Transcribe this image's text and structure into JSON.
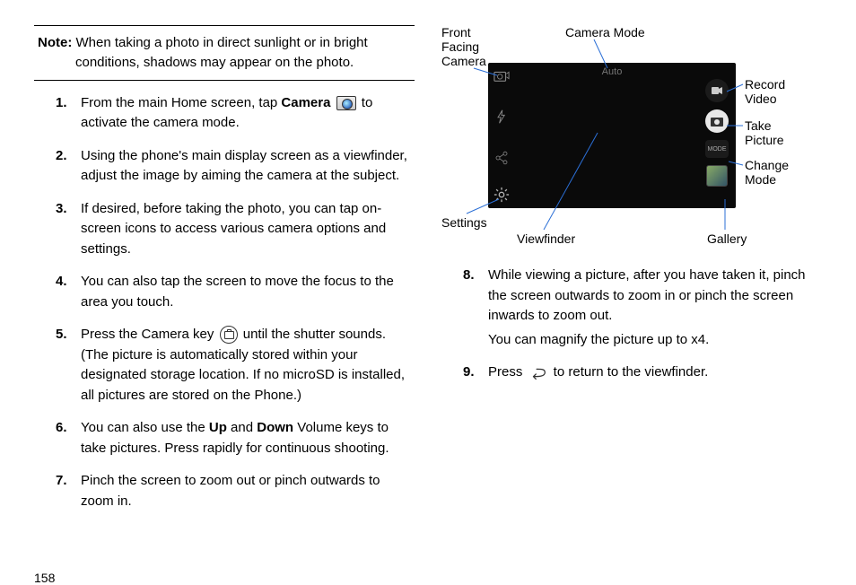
{
  "note": {
    "prefix": "Note:",
    "text": " When taking a photo in direct sunlight or in bright conditions, shadows may appear on the photo."
  },
  "steps_left": [
    {
      "num": "1.",
      "html": "From the main Home screen, tap <b>Camera</b> {camera} to activate the camera mode."
    },
    {
      "num": "2.",
      "html": "Using the phone's main display screen as a viewfinder, adjust the image by aiming the camera at the subject."
    },
    {
      "num": "3.",
      "html": "If desired, before taking the photo, you can tap on-screen icons to access various camera options and settings."
    },
    {
      "num": "4.",
      "html": "You can also tap the screen to move the focus to the area you touch."
    },
    {
      "num": "5.",
      "html": "Press the Camera key {key} until the shutter sounds. (The picture is automatically stored within your designated storage location. If no microSD is installed, all pictures are stored on the Phone.)"
    },
    {
      "num": "6.",
      "html": "You can also use the <b>Up</b> and <b>Down</b> Volume keys to take pictures. Press rapidly for continuous shooting."
    },
    {
      "num": "7.",
      "html": "Pinch the screen to zoom out or pinch outwards to zoom in."
    }
  ],
  "steps_right": [
    {
      "num": "8.",
      "html": "While viewing a picture, after you have taken it, pinch the screen outwards to zoom in or pinch the screen inwards to zoom out.",
      "extra": "You can magnify the picture up to x4."
    },
    {
      "num": "9.",
      "html": "Press {back} to return to the viewfinder."
    }
  ],
  "diagram": {
    "front_camera": "Front\nFacing\nCamera",
    "camera_mode": "Camera  Mode",
    "record_video": "Record\nVideo",
    "take_picture": "Take\nPicture",
    "change_mode": "Change\nMode",
    "gallery": "Gallery",
    "viewfinder": "Viewfinder",
    "settings": "Settings",
    "auto": "Auto",
    "mode_btn": "MODE"
  },
  "page_number": "158"
}
